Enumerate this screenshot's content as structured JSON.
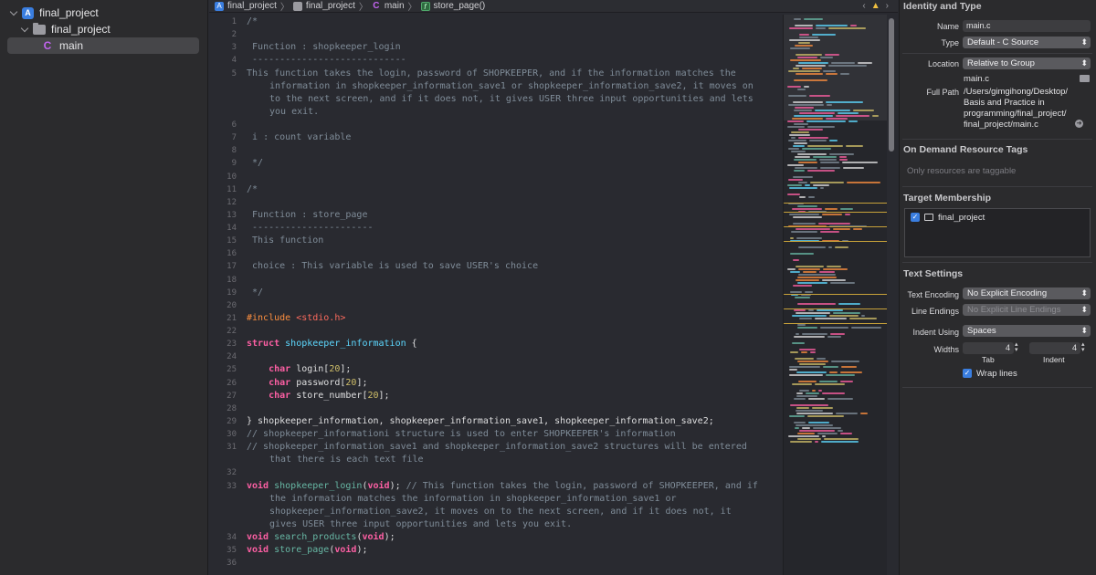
{
  "navigator": {
    "project": "final_project",
    "group": "final_project",
    "file": "main"
  },
  "jumpbar": {
    "crumbs": [
      "final_project",
      "final_project",
      "main",
      "store_page()"
    ]
  },
  "editor": {
    "line_numbers": [
      "1",
      "2",
      "3",
      "4",
      "5",
      "6",
      "7",
      "8",
      "9",
      "10",
      "11",
      "12",
      "13",
      "14",
      "15",
      "16",
      "17",
      "18",
      "19",
      "20",
      "21",
      "22",
      "23",
      "24",
      "25",
      "26",
      "27",
      "28",
      "29",
      "30",
      "31",
      "32",
      "33",
      "34",
      "35",
      "36"
    ]
  },
  "inspector": {
    "identity_title": "Identity and Type",
    "name_label": "Name",
    "name_value": "main.c",
    "type_label": "Type",
    "type_value": "Default - C Source",
    "location_label": "Location",
    "location_value": "Relative to Group",
    "location_file": "main.c",
    "fullpath_label": "Full Path",
    "fullpath_lines": [
      "/Users/gimgihong/Desktop/",
      "Basis and Practice in",
      "programming/final_project/",
      "final_project/main.c"
    ],
    "odr_title": "On Demand Resource Tags",
    "odr_placeholder": "Only resources are taggable",
    "target_title": "Target Membership",
    "target_item": "final_project",
    "text_settings_title": "Text Settings",
    "encoding_label": "Text Encoding",
    "encoding_value": "No Explicit Encoding",
    "line_endings_label": "Line Endings",
    "line_endings_value": "No Explicit Line Endings",
    "indent_label": "Indent Using",
    "indent_value": "Spaces",
    "widths_label": "Widths",
    "tab_value": "4",
    "indent_value_num": "4",
    "tab_caption": "Tab",
    "indent_caption": "Indent",
    "wrap_label": "Wrap lines"
  }
}
